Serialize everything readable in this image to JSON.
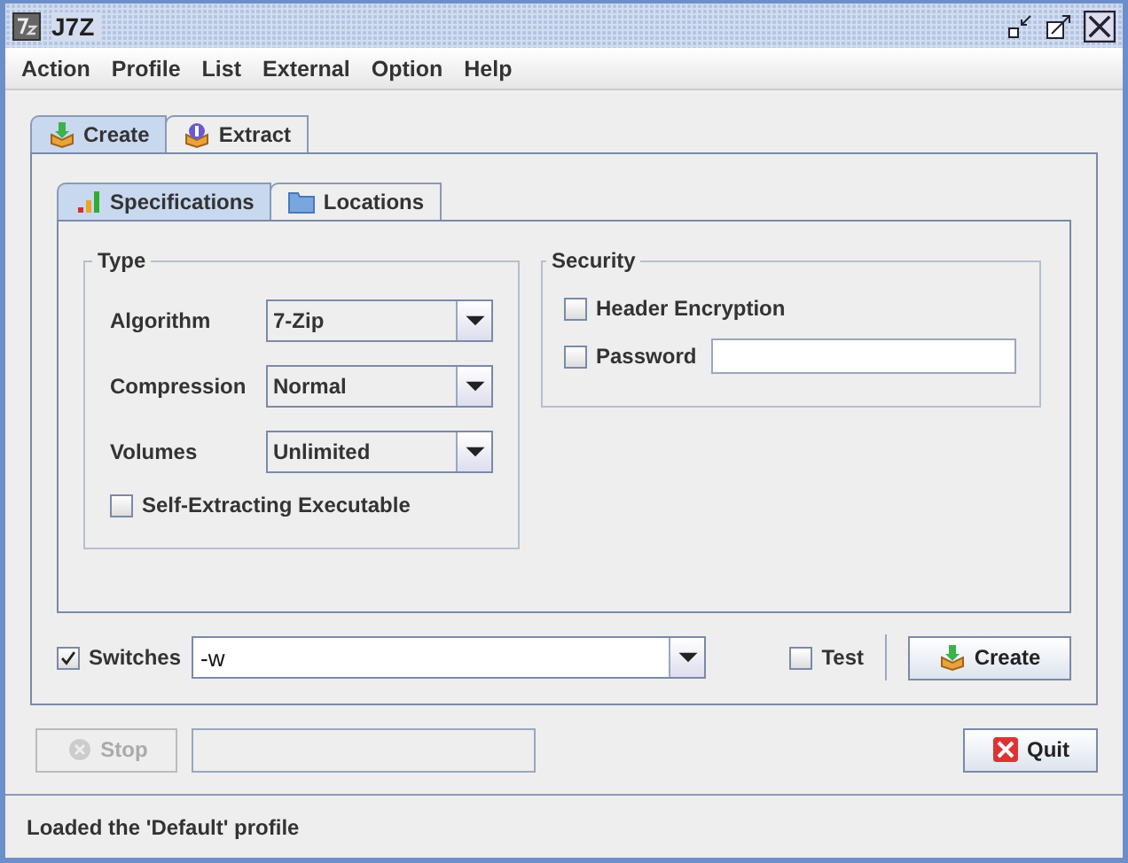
{
  "window": {
    "title": "J7Z"
  },
  "menu": [
    "Action",
    "Profile",
    "List",
    "External",
    "Option",
    "Help"
  ],
  "main_tabs": [
    {
      "label": "Create",
      "selected": true,
      "kind": "create"
    },
    {
      "label": "Extract",
      "selected": false,
      "kind": "extract"
    }
  ],
  "sub_tabs": [
    {
      "label": "Specifications",
      "selected": true,
      "kind": "bars"
    },
    {
      "label": "Locations",
      "selected": false,
      "kind": "folder"
    }
  ],
  "type_group": {
    "title": "Type",
    "fields": [
      {
        "label": "Algorithm",
        "value": "7-Zip"
      },
      {
        "label": "Compression",
        "value": "Normal"
      },
      {
        "label": "Volumes",
        "value": "Unlimited"
      }
    ],
    "self_extracting": {
      "label": "Self-Extracting Executable",
      "checked": false
    }
  },
  "security_group": {
    "title": "Security",
    "header_encryption": {
      "label": "Header Encryption",
      "checked": false
    },
    "password": {
      "label": "Password",
      "checked": false
    }
  },
  "switches": {
    "label": "Switches",
    "checked": true,
    "value": "-w"
  },
  "test": {
    "label": "Test",
    "checked": false
  },
  "create_button": "Create",
  "stop_button": {
    "label": "Stop",
    "disabled": true
  },
  "quit_button": "Quit",
  "status_bar": "Loaded the 'Default' profile"
}
